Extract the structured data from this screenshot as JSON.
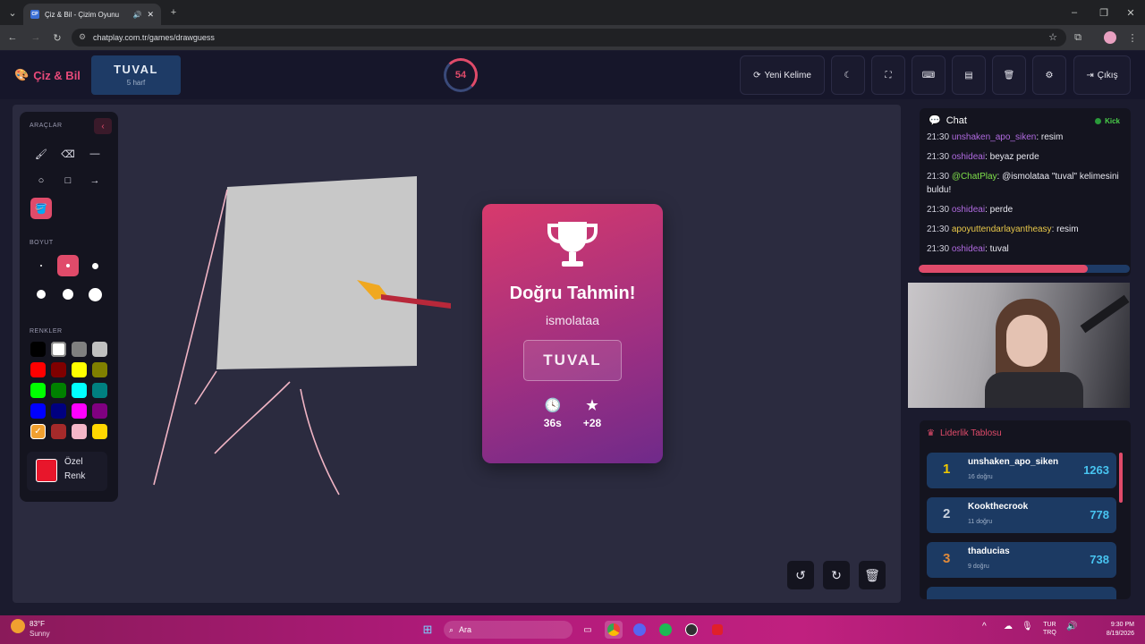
{
  "browser": {
    "tab_title": "Çiz & Bil - Çizim Oyunu",
    "favicon_text": "CP",
    "url": "chatplay.com.tr/games/drawguess",
    "new_tab": "+"
  },
  "header": {
    "logo": "Çiz & Bil",
    "word": "TUVAL",
    "word_hint": "5 harf",
    "timer": "54",
    "new_word_label": "Yeni Kelime",
    "exit_label": "Çıkış"
  },
  "tools": {
    "section_tools": "ARAÇLAR",
    "section_size": "BOYUT",
    "section_colors": "RENKLER",
    "custom_color_label_1": "Özel",
    "custom_color_label_2": "Renk",
    "custom_color": "#e8162b",
    "palette": [
      "#000000",
      "#ffffff",
      "#808080",
      "#c0c0c0",
      "#ff0000",
      "#800000",
      "#ffff00",
      "#808000",
      "#00ff00",
      "#008000",
      "#00ffff",
      "#008080",
      "#0000ff",
      "#000080",
      "#ff00ff",
      "#800080",
      "#f0a030",
      "#a52a2a",
      "#f4b6c8",
      "#ffd700"
    ]
  },
  "result": {
    "title": "Doğru Tahmin!",
    "user": "ismolataa",
    "word": "TUVAL",
    "time": "36s",
    "points": "+28"
  },
  "chat": {
    "title": "Chat",
    "platform": "Kick",
    "messages": [
      {
        "time": "21:30",
        "user": "unshaken_apo_siken",
        "text": ": resim",
        "color": "#b06ae0"
      },
      {
        "time": "21:30",
        "user": "oshideai",
        "text": ": beyaz perde",
        "color": "#b06ae0"
      },
      {
        "time": "21:30",
        "user": "@ChatPlay",
        "text": ": @ismolataa \"tuval\" kelimesini buldu!",
        "color": "#7fe04a"
      },
      {
        "time": "21:30",
        "user": "oshideai",
        "text": ": perde",
        "color": "#b06ae0"
      },
      {
        "time": "21:30",
        "user": "apoyuttendarlayantheasy",
        "text": ": resim",
        "color": "#e8c84a"
      },
      {
        "time": "21:30",
        "user": "oshideai",
        "text": ": tuval",
        "color": "#b06ae0"
      }
    ],
    "progress": 0.8
  },
  "leaderboard": {
    "title": "Liderlik Tablosu",
    "rows": [
      {
        "rank": "1",
        "name": "unshaken_apo_siken",
        "sub": "16 doğru",
        "score": "1263",
        "rank_color": "#f0c800"
      },
      {
        "rank": "2",
        "name": "Kookthecrook",
        "sub": "11 doğru",
        "score": "778",
        "rank_color": "#c8d0dc"
      },
      {
        "rank": "3",
        "name": "thaducias",
        "sub": "9 doğru",
        "score": "738",
        "rank_color": "#e08a3a"
      }
    ]
  },
  "taskbar": {
    "weather_temp": "83°F",
    "weather_desc": "Sunny",
    "search_label": "Ara",
    "lang_1": "TUR",
    "lang_2": "TRQ",
    "time": "9:30 PM",
    "date": "8/19/2026"
  }
}
